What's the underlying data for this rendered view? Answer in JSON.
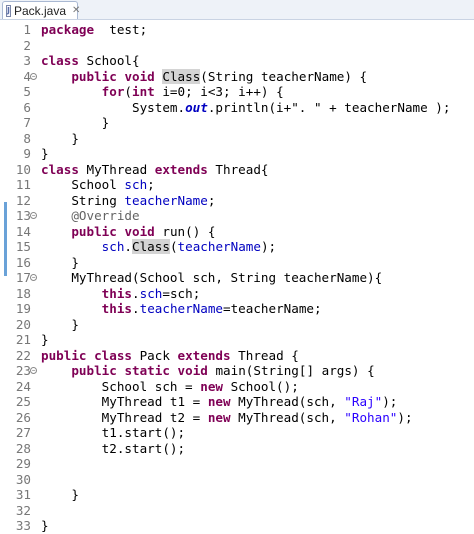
{
  "tab": {
    "title": "Pack.java",
    "icon": "J"
  },
  "colors": {
    "keyword": "#7f0055",
    "field": "#0000c0",
    "string": "#2a00ff",
    "annotation": "#646464",
    "line_number": "#787878"
  },
  "lines": [
    {
      "n": "1",
      "fold": false,
      "tokens": [
        [
          "kw",
          "package"
        ],
        [
          "",
          "  test;"
        ]
      ]
    },
    {
      "n": "2",
      "fold": false,
      "tokens": []
    },
    {
      "n": "3",
      "fold": false,
      "tokens": [
        [
          "kw",
          "class"
        ],
        [
          "",
          " School{"
        ]
      ]
    },
    {
      "n": "4",
      "fold": true,
      "tokens": [
        [
          "",
          "    "
        ],
        [
          "kw",
          "public"
        ],
        [
          "",
          " "
        ],
        [
          "kw",
          "void"
        ],
        [
          "",
          " "
        ],
        [
          "hl",
          "Class"
        ],
        [
          "",
          "(String teacherName) {"
        ]
      ]
    },
    {
      "n": "5",
      "fold": false,
      "tokens": [
        [
          "",
          "        "
        ],
        [
          "kw",
          "for"
        ],
        [
          "",
          "("
        ],
        [
          "kw",
          "int"
        ],
        [
          "",
          " i=0; i<3; i++) {"
        ]
      ]
    },
    {
      "n": "6",
      "fold": false,
      "tokens": [
        [
          "",
          "            System."
        ],
        [
          "sfld",
          "out"
        ],
        [
          "",
          ".println(i+\". \" + teacherName );"
        ]
      ]
    },
    {
      "n": "7",
      "fold": false,
      "tokens": [
        [
          "",
          "        }"
        ]
      ]
    },
    {
      "n": "8",
      "fold": false,
      "tokens": [
        [
          "",
          "    }"
        ]
      ]
    },
    {
      "n": "9",
      "fold": false,
      "tokens": [
        [
          "",
          "}"
        ]
      ]
    },
    {
      "n": "10",
      "fold": false,
      "tokens": [
        [
          "kw",
          "class"
        ],
        [
          "",
          " MyThread "
        ],
        [
          "kw",
          "extends"
        ],
        [
          "",
          " Thread{"
        ]
      ]
    },
    {
      "n": "11",
      "fold": false,
      "tokens": [
        [
          "",
          "    School "
        ],
        [
          "fld",
          "sch"
        ],
        [
          "",
          ";"
        ]
      ]
    },
    {
      "n": "12",
      "fold": false,
      "tokens": [
        [
          "",
          "    String "
        ],
        [
          "fld",
          "teacherName"
        ],
        [
          "",
          ";"
        ]
      ]
    },
    {
      "n": "13",
      "fold": true,
      "tokens": [
        [
          "ann",
          "    @Override"
        ]
      ]
    },
    {
      "n": "14",
      "fold": false,
      "tokens": [
        [
          "",
          "    "
        ],
        [
          "kw",
          "public"
        ],
        [
          "",
          " "
        ],
        [
          "kw",
          "void"
        ],
        [
          "",
          " run() {"
        ]
      ]
    },
    {
      "n": "15",
      "fold": false,
      "tokens": [
        [
          "",
          "        "
        ],
        [
          "fld",
          "sch"
        ],
        [
          "",
          "."
        ],
        [
          "hl",
          "Class"
        ],
        [
          "",
          "("
        ],
        [
          "fld",
          "teacherName"
        ],
        [
          "",
          ");"
        ]
      ]
    },
    {
      "n": "16",
      "fold": false,
      "tokens": [
        [
          "",
          "    }"
        ]
      ]
    },
    {
      "n": "17",
      "fold": true,
      "tokens": [
        [
          "",
          "    MyThread(School sch, String teacherName){"
        ]
      ]
    },
    {
      "n": "18",
      "fold": false,
      "tokens": [
        [
          "",
          "        "
        ],
        [
          "kw",
          "this"
        ],
        [
          "",
          "."
        ],
        [
          "fld",
          "sch"
        ],
        [
          "",
          "=sch;"
        ]
      ]
    },
    {
      "n": "19",
      "fold": false,
      "tokens": [
        [
          "",
          "        "
        ],
        [
          "kw",
          "this"
        ],
        [
          "",
          "."
        ],
        [
          "fld",
          "teacherName"
        ],
        [
          "",
          "=teacherName;"
        ]
      ]
    },
    {
      "n": "20",
      "fold": false,
      "tokens": [
        [
          "",
          "    }"
        ]
      ]
    },
    {
      "n": "21",
      "fold": false,
      "tokens": [
        [
          "",
          "}"
        ]
      ]
    },
    {
      "n": "22",
      "fold": false,
      "tokens": [
        [
          "kw",
          "public"
        ],
        [
          "",
          " "
        ],
        [
          "kw",
          "class"
        ],
        [
          "",
          " Pack "
        ],
        [
          "kw",
          "extends"
        ],
        [
          "",
          " Thread {"
        ]
      ]
    },
    {
      "n": "23",
      "fold": true,
      "tokens": [
        [
          "",
          "    "
        ],
        [
          "kw",
          "public"
        ],
        [
          "",
          " "
        ],
        [
          "kw",
          "static"
        ],
        [
          "",
          " "
        ],
        [
          "kw",
          "void"
        ],
        [
          "",
          " main(String[] args) {"
        ]
      ]
    },
    {
      "n": "24",
      "fold": false,
      "tokens": [
        [
          "",
          "        School sch = "
        ],
        [
          "kw",
          "new"
        ],
        [
          "",
          " School();"
        ]
      ]
    },
    {
      "n": "25",
      "fold": false,
      "tokens": [
        [
          "",
          "        MyThread t1 = "
        ],
        [
          "kw",
          "new"
        ],
        [
          "",
          " MyThread(sch, "
        ],
        [
          "str",
          "\"Raj\""
        ],
        [
          "",
          ");"
        ]
      ]
    },
    {
      "n": "26",
      "fold": false,
      "tokens": [
        [
          "",
          "        MyThread t2 = "
        ],
        [
          "kw",
          "new"
        ],
        [
          "",
          " MyThread(sch, "
        ],
        [
          "str",
          "\"Rohan\""
        ],
        [
          "",
          ");"
        ]
      ]
    },
    {
      "n": "27",
      "fold": false,
      "tokens": [
        [
          "",
          "        t1.start();"
        ]
      ]
    },
    {
      "n": "28",
      "fold": false,
      "tokens": [
        [
          "",
          "        t2.start();"
        ]
      ]
    },
    {
      "n": "29",
      "fold": false,
      "tokens": []
    },
    {
      "n": "30",
      "fold": false,
      "tokens": []
    },
    {
      "n": "31",
      "fold": false,
      "tokens": [
        [
          "",
          "    }"
        ]
      ]
    },
    {
      "n": "32",
      "fold": false,
      "tokens": []
    },
    {
      "n": "33",
      "fold": false,
      "tokens": [
        [
          "",
          "}"
        ]
      ]
    }
  ]
}
